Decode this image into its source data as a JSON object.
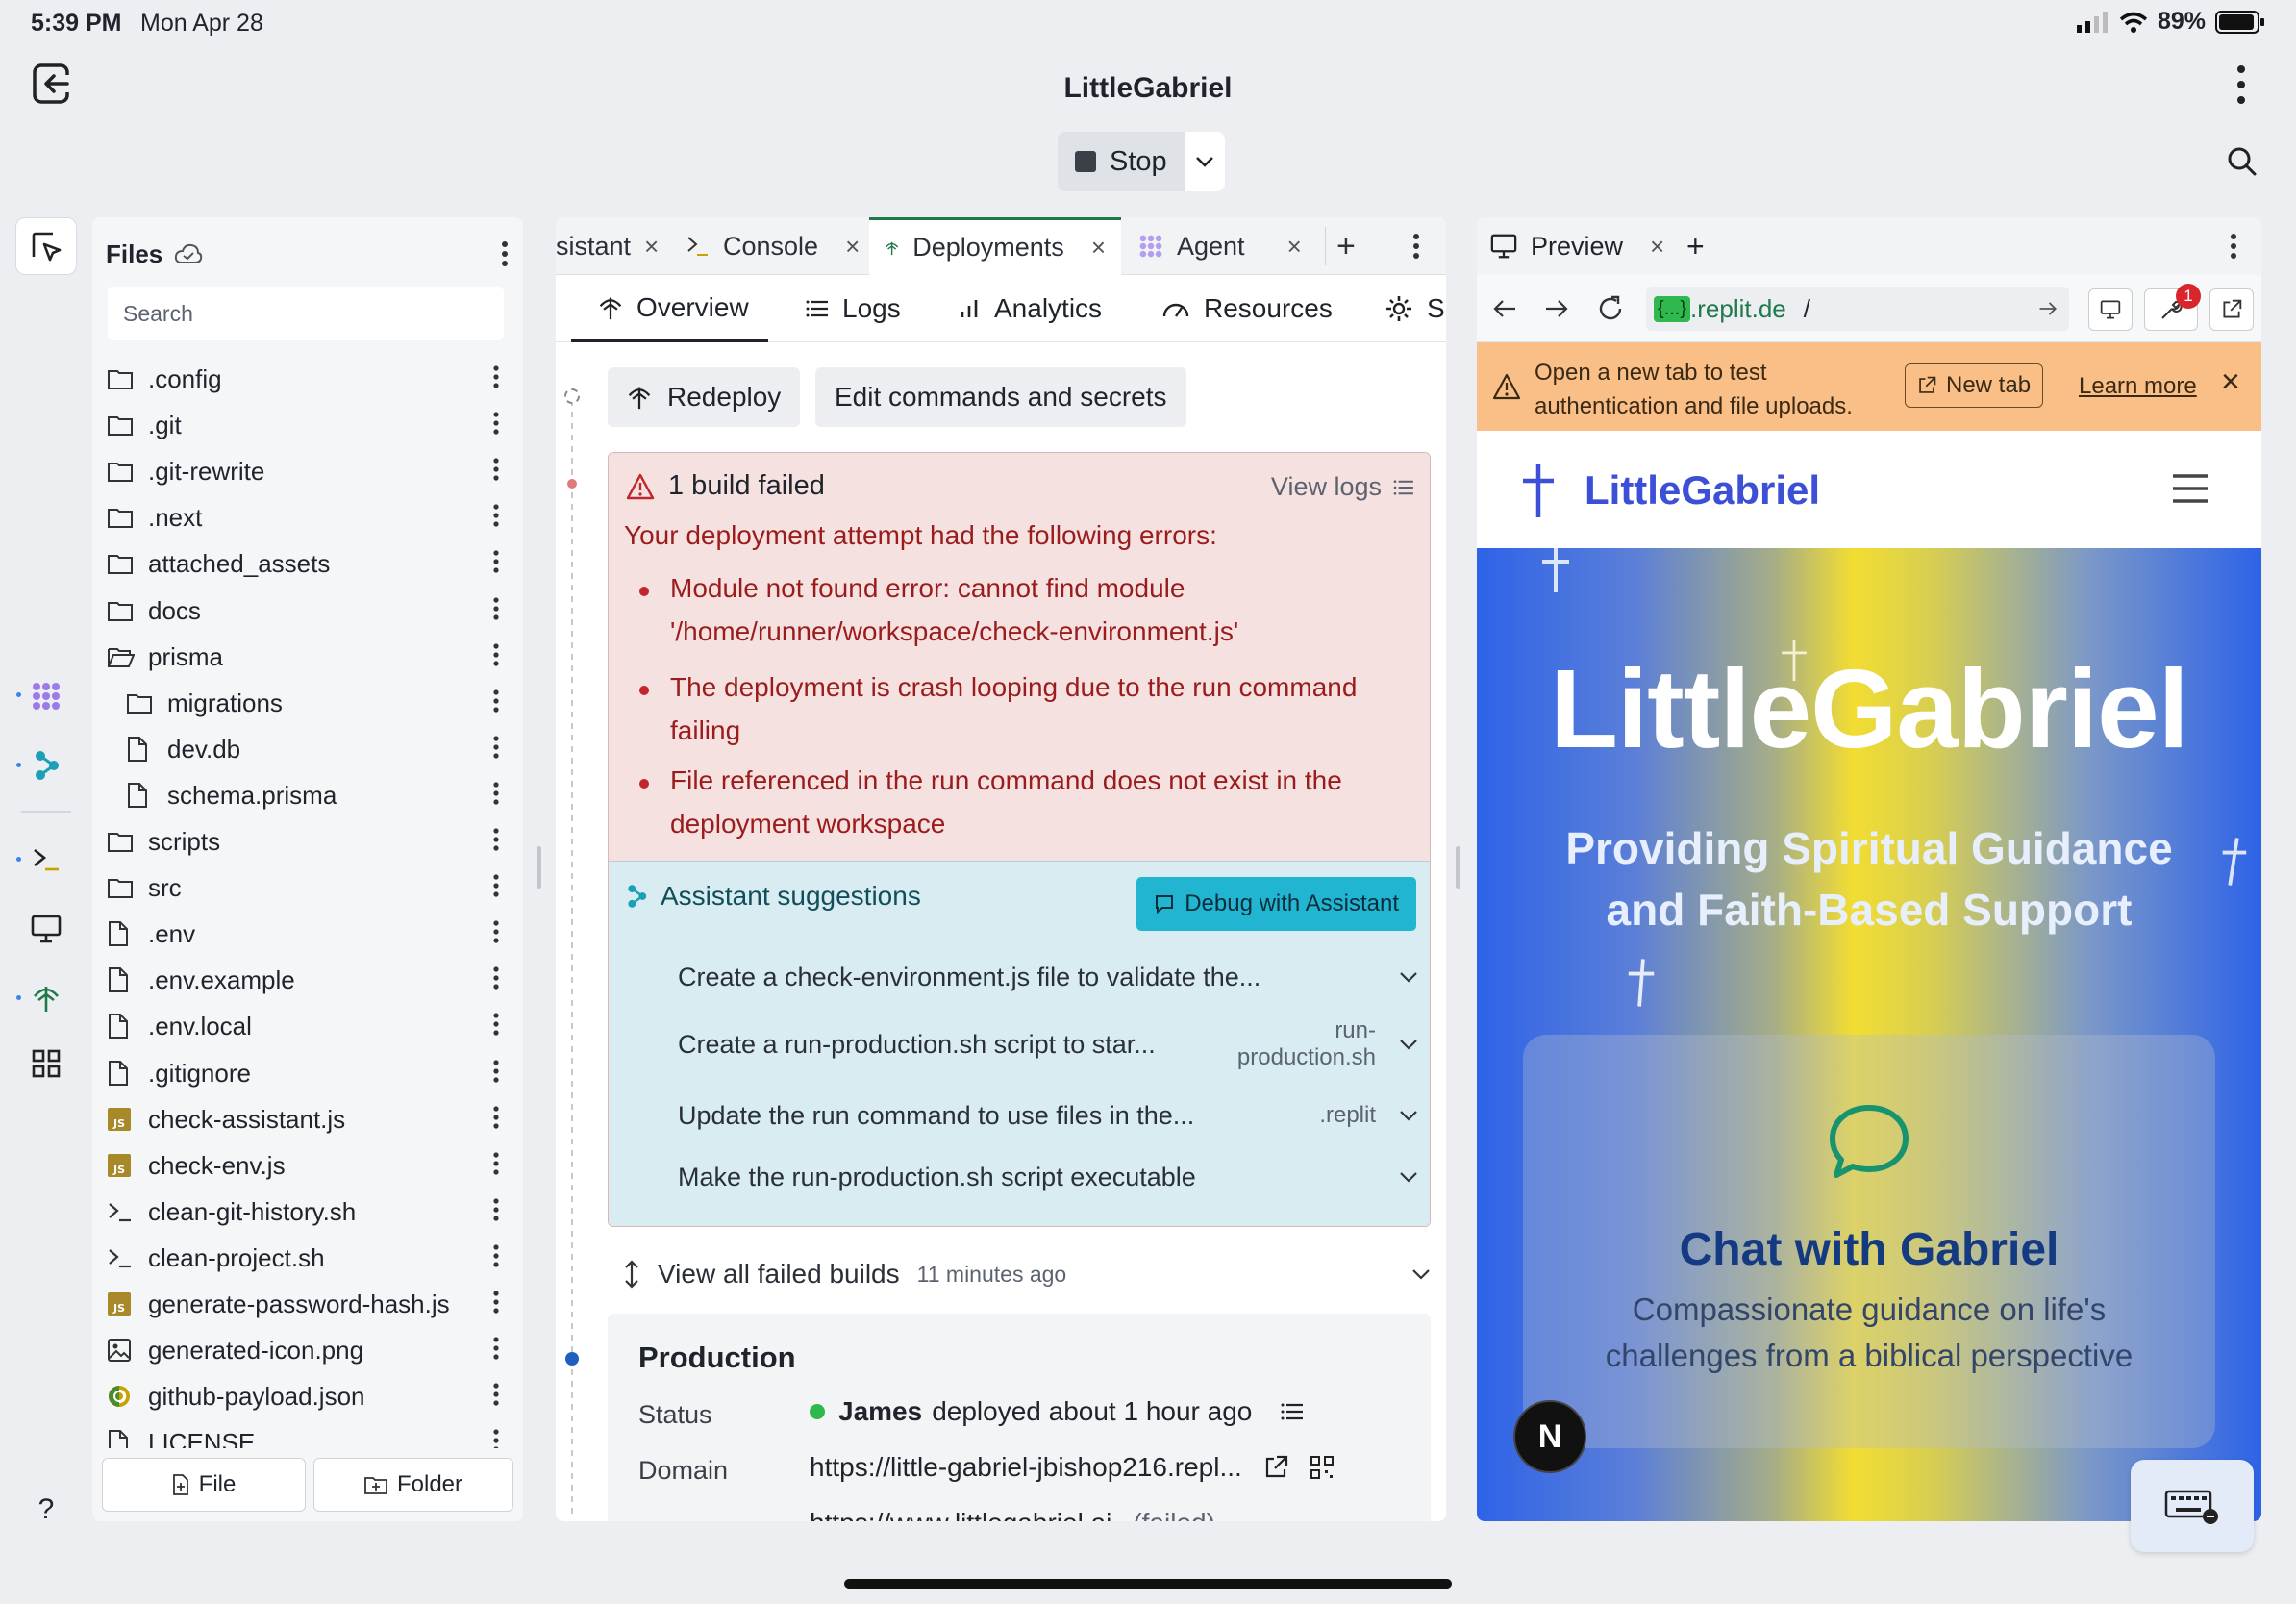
{
  "status": {
    "time": "5:39 PM",
    "date": "Mon Apr 28",
    "battery": "89%"
  },
  "app": {
    "title": "LittleGabriel",
    "stop_label": "Stop"
  },
  "files": {
    "title": "Files",
    "search_placeholder": "Search",
    "items": [
      {
        "name": ".config",
        "type": "folder"
      },
      {
        "name": ".git",
        "type": "folder"
      },
      {
        "name": ".git-rewrite",
        "type": "folder"
      },
      {
        "name": ".next",
        "type": "folder"
      },
      {
        "name": "attached_assets",
        "type": "folder"
      },
      {
        "name": "docs",
        "type": "folder"
      },
      {
        "name": "prisma",
        "type": "folder-open"
      },
      {
        "name": "migrations",
        "type": "folder",
        "indent": true
      },
      {
        "name": "dev.db",
        "type": "file",
        "indent": true
      },
      {
        "name": "schema.prisma",
        "type": "file",
        "indent": true
      },
      {
        "name": "scripts",
        "type": "folder"
      },
      {
        "name": "src",
        "type": "folder"
      },
      {
        "name": ".env",
        "type": "file"
      },
      {
        "name": ".env.example",
        "type": "file"
      },
      {
        "name": ".env.local",
        "type": "file"
      },
      {
        "name": ".gitignore",
        "type": "file"
      },
      {
        "name": "check-assistant.js",
        "type": "js"
      },
      {
        "name": "check-env.js",
        "type": "js"
      },
      {
        "name": "clean-git-history.sh",
        "type": "shell"
      },
      {
        "name": "clean-project.sh",
        "type": "shell"
      },
      {
        "name": "generate-password-hash.js",
        "type": "js"
      },
      {
        "name": "generated-icon.png",
        "type": "image"
      },
      {
        "name": "github-payload.json",
        "type": "json"
      },
      {
        "name": "LICENSE",
        "type": "file"
      }
    ],
    "new_file_label": "File",
    "new_folder_label": "Folder"
  },
  "tabs": [
    {
      "label": "sistant"
    },
    {
      "label": "Console"
    },
    {
      "label": "Deployments"
    },
    {
      "label": "Agent"
    }
  ],
  "subtabs": [
    "Overview",
    "Logs",
    "Analytics",
    "Resources",
    "S"
  ],
  "deploy": {
    "redeploy": "Redeploy",
    "edit": "Edit commands and secrets",
    "error_title": "1 build failed",
    "view_logs": "View logs",
    "error_intro": "Your deployment attempt had the following errors:",
    "errors": [
      {
        "line1": "Module not found error: cannot find module",
        "line2": "'/home/runner/workspace/check-environment.js'"
      },
      {
        "line1": "The deployment is crash looping due to the run command",
        "line2": "failing"
      },
      {
        "line1": "File referenced in the run command does not exist in the",
        "line2": "deployment workspace"
      }
    ],
    "suggestions_title": "Assistant suggestions",
    "debug_label": "Debug with Assistant",
    "suggestions": [
      {
        "text": "Create a check-environment.js file to validate the...",
        "meta1": "",
        "meta2": ""
      },
      {
        "text": "Create a run-production.sh script to star...",
        "meta1": "run-",
        "meta2": "production.sh"
      },
      {
        "text": "Update the run command to use files in the...",
        "meta1": ".replit",
        "meta2": ""
      },
      {
        "text": "Make the run-production.sh script executable",
        "meta1": "",
        "meta2": ""
      }
    ],
    "view_all": "View all failed builds",
    "view_all_time": "11 minutes ago",
    "production_title": "Production",
    "status_label": "Status",
    "status_user": "James",
    "status_text": "deployed about 1 hour ago",
    "domain_label": "Domain",
    "domain_value": "https://little-gabriel-jbishop216.repl...",
    "domain2": "https://www.littlegabriel.ai",
    "domain2_status": "(failed)"
  },
  "preview": {
    "tab_label": "Preview",
    "url_chip": "{...}",
    "url_domain": ".replit.de",
    "url_path": "/",
    "notif_count": "1",
    "warning_line1": "Open a new tab to test",
    "warning_line2": "authentication and file uploads.",
    "new_tab_label": "New tab",
    "learn_more": "Learn more",
    "site_name": "LittleGabriel",
    "hero_title": "LittleGabriel",
    "hero_sub1": "Providing Spiritual Guidance",
    "hero_sub2": "and Faith-Based Support",
    "card_title": "Chat with Gabriel",
    "card_desc1": "Compassionate guidance on life's",
    "card_desc2": "challenges from a biblical perspective",
    "badge": "N"
  },
  "colors": {
    "accent": "#21b5d1",
    "error": "#9b1c1c",
    "brand": "#3d4fd6",
    "warning_bg": "#f9bf86"
  }
}
